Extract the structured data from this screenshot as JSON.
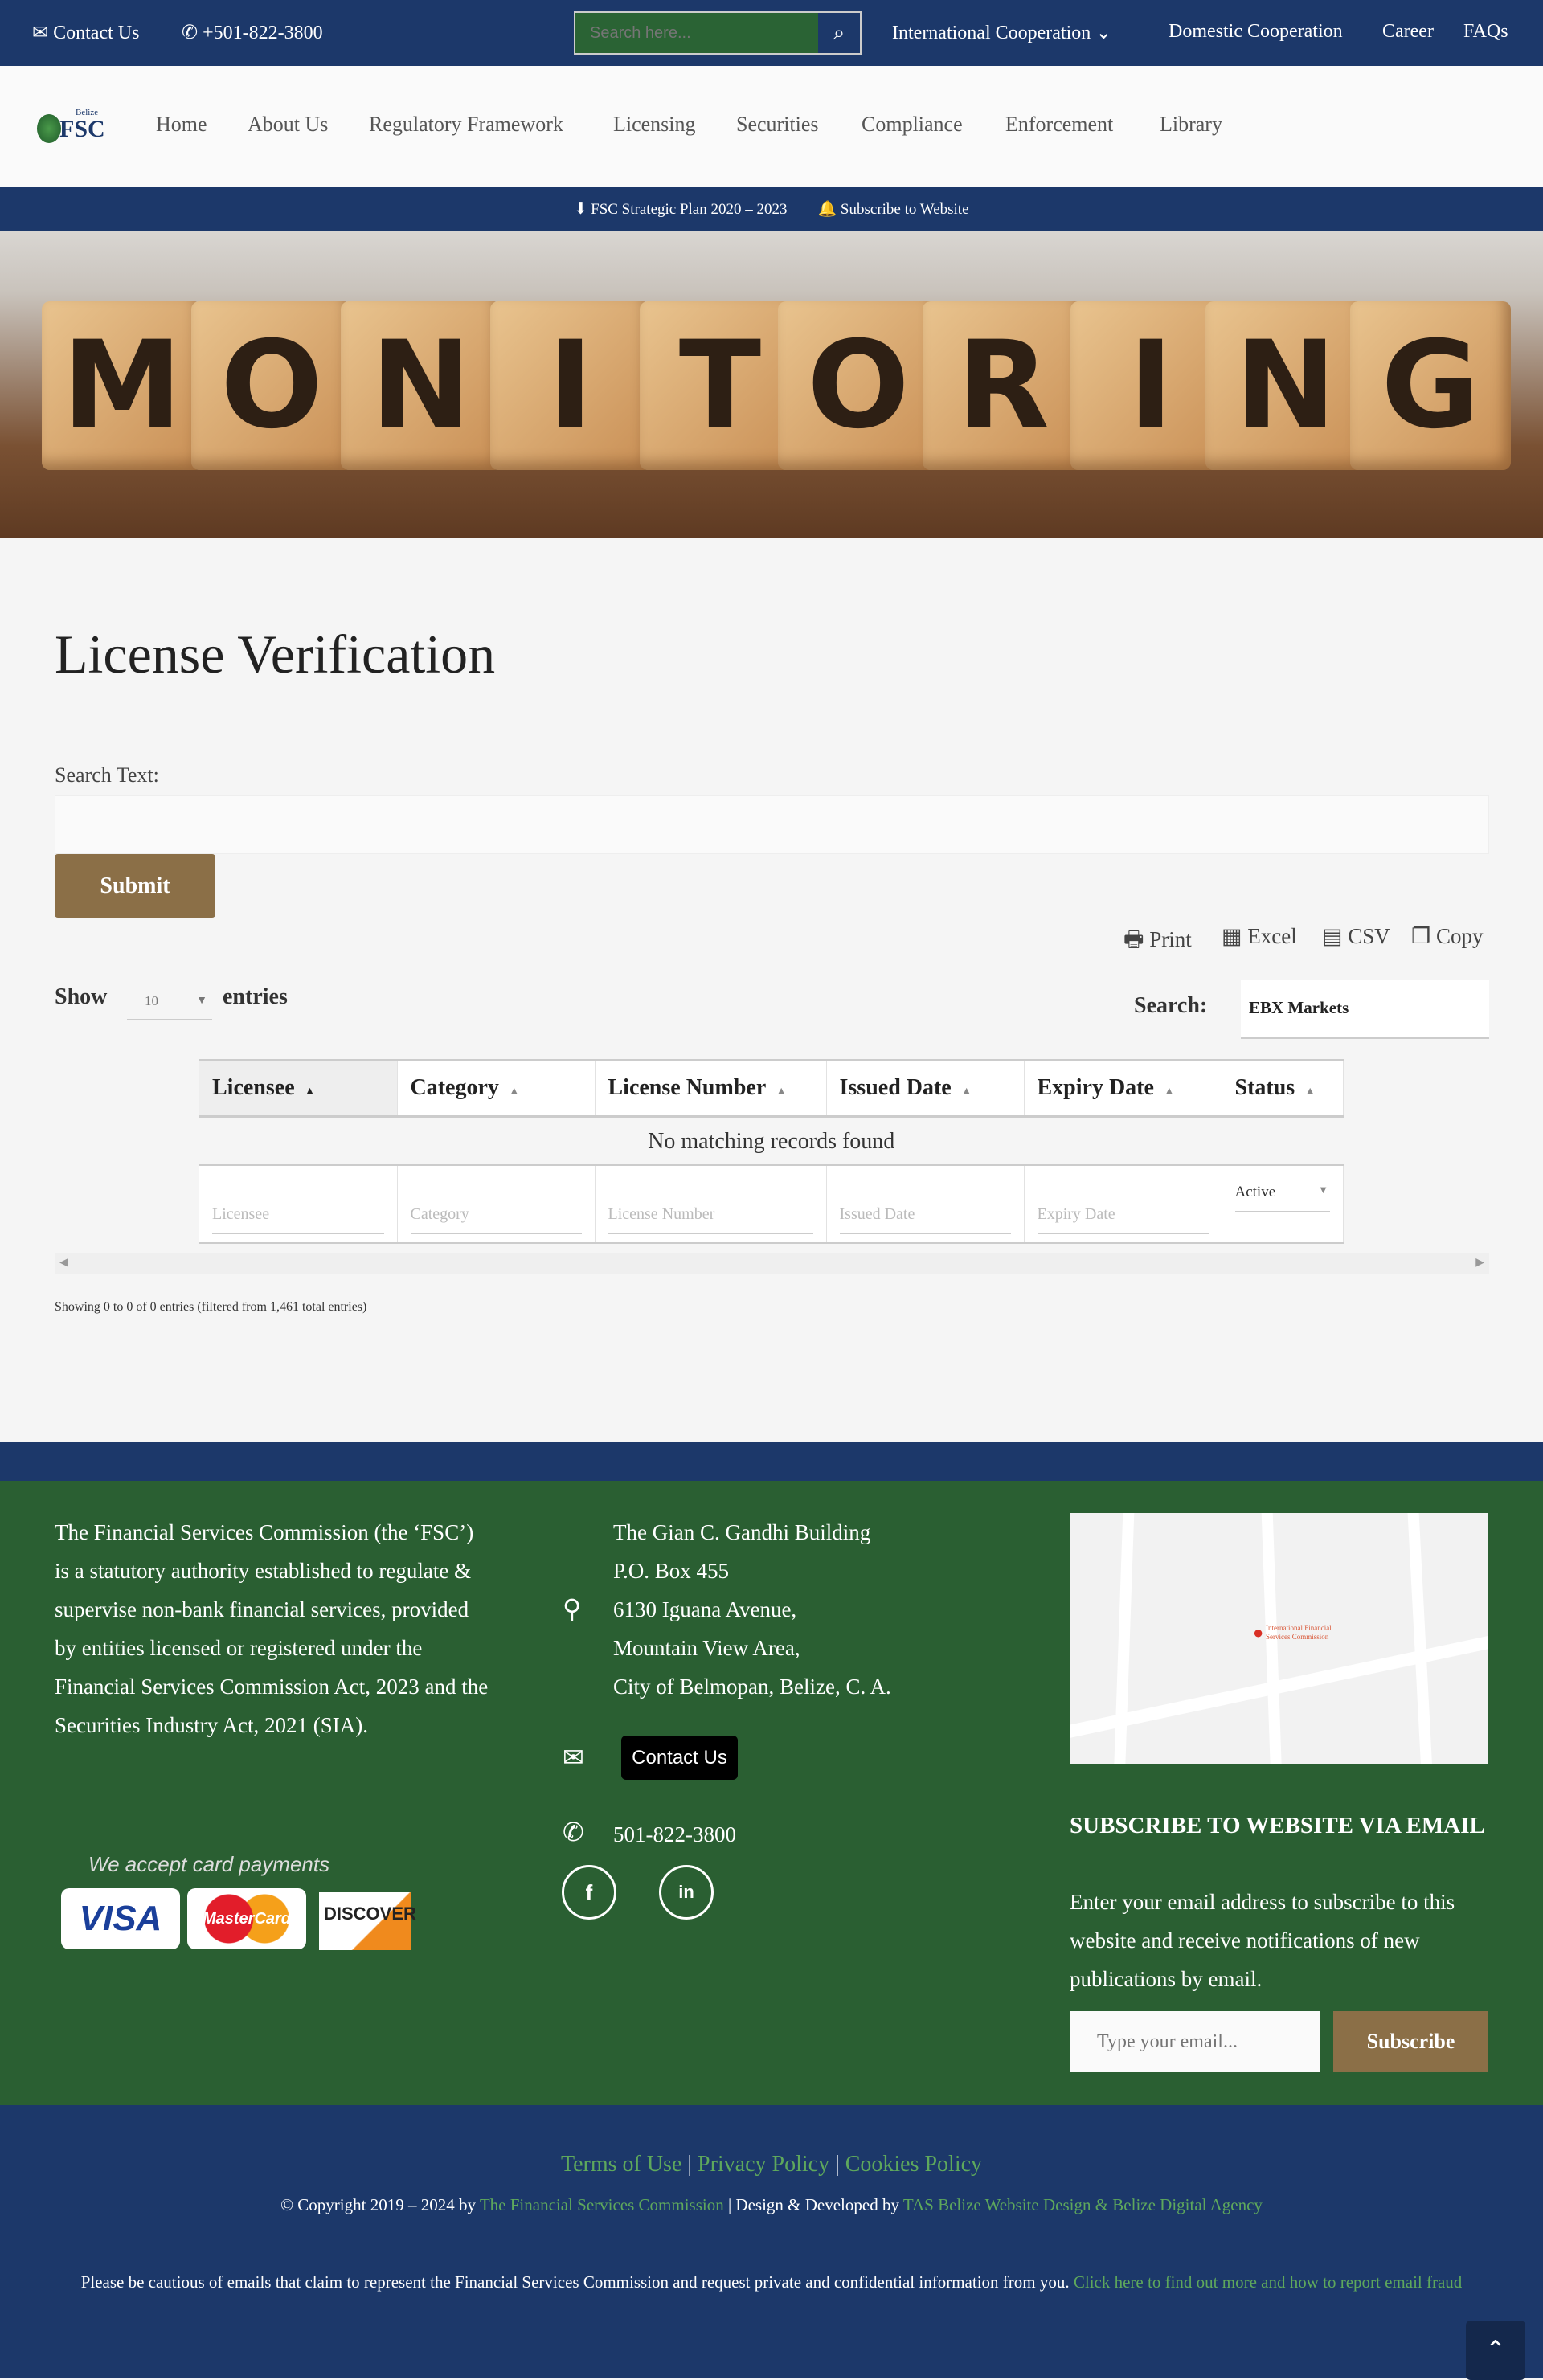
{
  "topbar": {
    "contact": "Contact Us",
    "phone": "+501-822-3800",
    "search_placeholder": "Search here...",
    "links": [
      "International Cooperation",
      "Domestic Cooperation",
      "Career",
      "FAQs"
    ]
  },
  "logo": {
    "top": "Belize",
    "main": "FSC"
  },
  "nav": [
    "Home",
    "About Us",
    "Regulatory Framework",
    "Licensing",
    "Securities",
    "Compliance",
    "Enforcement",
    "Library"
  ],
  "strip": {
    "plan": "FSC Strategic Plan 2020 – 2023",
    "subscribe": "Subscribe to Website"
  },
  "hero": {
    "letters": [
      "M",
      "O",
      "N",
      "I",
      "T",
      "O",
      "R",
      "I",
      "N",
      "G"
    ]
  },
  "page": {
    "title": "License Verification",
    "search_label": "Search Text:",
    "search_value": "",
    "submit": "Submit"
  },
  "export": [
    "Print",
    "Excel",
    "CSV",
    "Copy"
  ],
  "table": {
    "show": "Show",
    "length": "10",
    "entries": "entries",
    "search_label": "Search:",
    "search_value": "EBX Markets",
    "columns": [
      "Licensee",
      "Category",
      "License Number",
      "Issued Date",
      "Expiry Date",
      "Status"
    ],
    "empty": "No matching records found",
    "filters": [
      "Licensee",
      "Category",
      "License Number",
      "Issued Date",
      "Expiry Date"
    ],
    "status_filter": "Active",
    "info": "Showing 0 to 0 of 0 entries (filtered from 1,461 total entries)"
  },
  "footer": {
    "about": "The Financial Services Commission (the ‘FSC’) is a statutory authority established to regulate & supervise non-bank financial services, provided by entities licensed or registered under the Financial Services Commission Act, 2023 and the Securities Industry Act, 2021 (SIA).",
    "address": [
      "The Gian C. Gandhi Building",
      "P.O. Box 455",
      "6130 Iguana Avenue,",
      "Mountain View Area,",
      "City of Belmopan, Belize, C. A."
    ],
    "contact_btn": "Contact Us",
    "phone": "501-822-3800",
    "cards_label": "We accept card payments",
    "cards": [
      "VISA",
      "MasterCard",
      "DISCOVER"
    ],
    "map_label": "International Financial Services Commission",
    "subscribe_title": "SUBSCRIBE TO WEBSITE VIA EMAIL",
    "subscribe_text": "Enter your email address to subscribe to this website and receive notifications of new publications by email.",
    "email_placeholder": "Type your email...",
    "subscribe_btn": "Subscribe"
  },
  "bottom": {
    "terms": "Terms of Use",
    "privacy": "Privacy Policy",
    "cookies": "Cookies Policy",
    "sep": "|",
    "copy": "© Copyright 2019 – 2024 by",
    "fsc": "The Financial Services Commission",
    "design": "| Design & Developed by",
    "agency": "TAS Belize Website Design & Belize Digital Agency",
    "warning": "Please be cautious of emails that claim to represent the Financial Services Commission and request private and confidential information from you.",
    "warning_link": "Click here to find out more and how to report email fraud"
  },
  "colors": {
    "navy": "#1c386a",
    "green": "#2a5f32",
    "gold": "#8b6f47",
    "link": "#5ea85c"
  }
}
